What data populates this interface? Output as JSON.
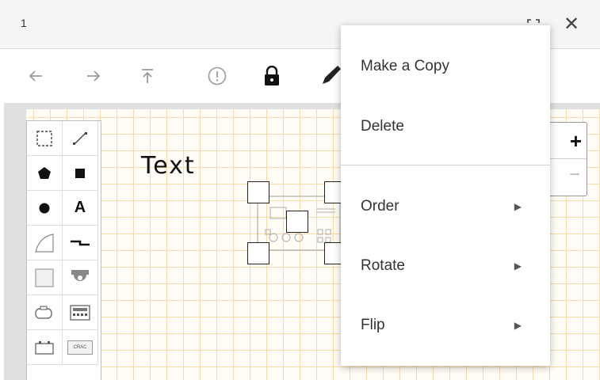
{
  "window": {
    "title": "1"
  },
  "toolbar": {
    "icons": [
      "undo-icon",
      "redo-icon",
      "bring-to-top-icon",
      "info-icon",
      "lock-icon",
      "pencil-icon"
    ]
  },
  "canvas": {
    "text_label": "Text"
  },
  "palette": {
    "items": [
      "select-rect-icon",
      "line-icon",
      "pentagon-icon",
      "square-icon",
      "circle-icon",
      "text-tool-icon",
      "curve-shape-icon",
      "connector-icon",
      "rack-icon",
      "camera-icon",
      "cylinder-icon",
      "panel-device-icon",
      "battery-icon",
      "crac-unit-icon"
    ],
    "text_tool_label": "A",
    "crac_label": "CRAC"
  },
  "zoom": {
    "in_label": "+",
    "out_label": "−"
  },
  "context_menu": {
    "items": [
      {
        "label": "Make a Copy",
        "submenu": false
      },
      {
        "label": "Delete",
        "submenu": false
      },
      {
        "label": "Order",
        "submenu": true
      },
      {
        "label": "Rotate",
        "submenu": true
      },
      {
        "label": "Flip",
        "submenu": true
      }
    ]
  },
  "colors": {
    "grid_line": "#f8dba8",
    "canvas_background": "#fffdf6",
    "titlebar": "#f5f5f5"
  }
}
